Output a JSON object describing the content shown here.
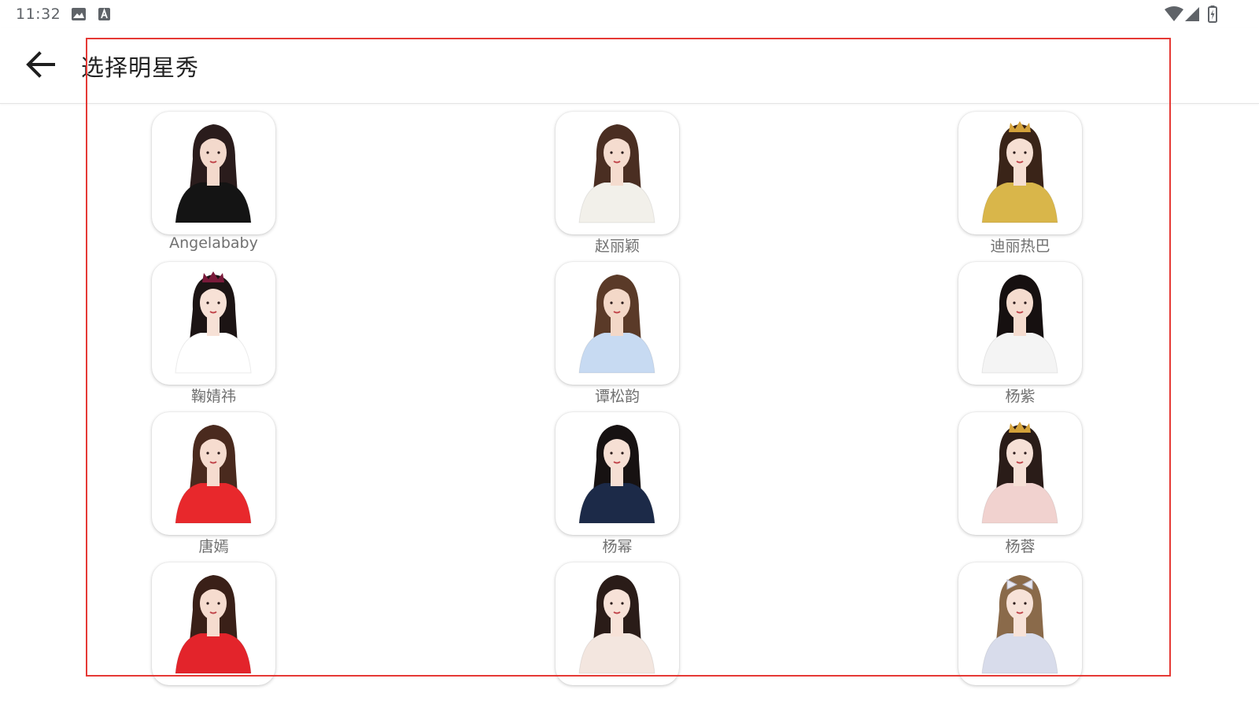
{
  "status_bar": {
    "time": "11:32",
    "left_icons": [
      "image-icon",
      "text-a-icon"
    ],
    "right_icons": [
      "wifi-icon",
      "signal-icon",
      "battery-charging-icon"
    ]
  },
  "app_bar": {
    "back_icon": "arrow-left-icon",
    "title": "选择明星秀"
  },
  "celebrities": [
    {
      "name": "Angelababy",
      "hair": "#2a1c1c",
      "outfit": "#141414",
      "skin": "#f3d9cc",
      "accessory": "none"
    },
    {
      "name": "赵丽颖",
      "hair": "#4a2e22",
      "outfit": "#f2f0ea",
      "skin": "#f5dccf",
      "accessory": "none"
    },
    {
      "name": "迪丽热巴",
      "hair": "#3a2418",
      "outfit": "#d9b64a",
      "skin": "#f6dfd3",
      "accessory": "gold-crown"
    },
    {
      "name": "鞠婧祎",
      "hair": "#1c1414",
      "outfit": "#ffffff",
      "skin": "#f7e1d6",
      "accessory": "crown"
    },
    {
      "name": "谭松韵",
      "hair": "#5a3a28",
      "outfit": "#c7daf2",
      "skin": "#f3d8c8",
      "accessory": "none"
    },
    {
      "name": "杨紫",
      "hair": "#161010",
      "outfit": "#f4f4f4",
      "skin": "#f5dccf",
      "accessory": "none"
    },
    {
      "name": "唐嫣",
      "hair": "#4a2a1e",
      "outfit": "#e8282c",
      "skin": "#f6dccf",
      "accessory": "none"
    },
    {
      "name": "杨幂",
      "hair": "#171212",
      "outfit": "#1c2a48",
      "skin": "#f6dfd4",
      "accessory": "none"
    },
    {
      "name": "杨蓉",
      "hair": "#2a1c18",
      "outfit": "#f1d2cf",
      "skin": "#f6e0d6",
      "accessory": "tiara"
    },
    {
      "name": "",
      "hair": "#3a2018",
      "outfit": "#e3242b",
      "skin": "#f6dccf",
      "accessory": "none"
    },
    {
      "name": "",
      "hair": "#2a1c18",
      "outfit": "#f3e6df",
      "skin": "#f7e2d8",
      "accessory": "none"
    },
    {
      "name": "",
      "hair": "#8a6a4a",
      "outfit": "#d8dceb",
      "skin": "#f7e2d8",
      "accessory": "bow"
    }
  ],
  "colors": {
    "selection_frame": "#e53935",
    "name_text": "#707070",
    "title_text": "#222222"
  }
}
